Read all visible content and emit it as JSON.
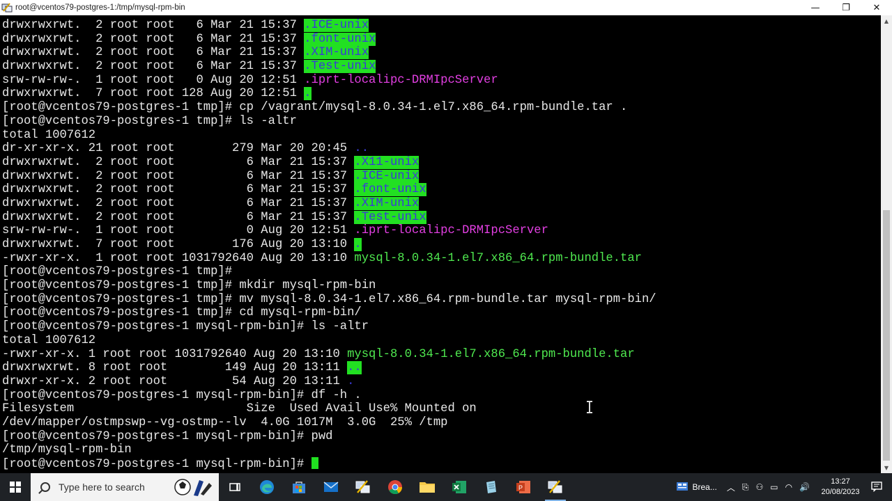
{
  "window": {
    "title": "root@vcentos79-postgres-1:/tmp/mysql-rpm-bin",
    "minimize_glyph": "—",
    "maximize_glyph": "❐",
    "close_glyph": "✕"
  },
  "terminal": {
    "lines": [
      [
        {
          "t": "drwxrwxrwt.  2 root root   6 Mar 21 15:37 "
        },
        {
          "t": ".ICE-unix",
          "c": "hl"
        }
      ],
      [
        {
          "t": "drwxrwxrwt.  2 root root   6 Mar 21 15:37 "
        },
        {
          "t": ".font-unix",
          "c": "hl"
        }
      ],
      [
        {
          "t": "drwxrwxrwt.  2 root root   6 Mar 21 15:37 "
        },
        {
          "t": ".XIM-unix",
          "c": "hl"
        }
      ],
      [
        {
          "t": "drwxrwxrwt.  2 root root   6 Mar 21 15:37 "
        },
        {
          "t": ".Test-unix",
          "c": "hl"
        }
      ],
      [
        {
          "t": "srw-rw-rw-.  1 root root   0 Aug 20 12:51 "
        },
        {
          "t": ".iprt-localipc-DRMIpcServer",
          "c": "magenta"
        }
      ],
      [
        {
          "t": "drwxrwxrwt.  7 root root 128 Aug 20 12:51 "
        },
        {
          "t": ".",
          "c": "hl"
        }
      ],
      [
        {
          "t": "[root@vcentos79-postgres-1 tmp]# cp /vagrant/mysql-8.0.34-1.el7.x86_64.rpm-bundle.tar ."
        }
      ],
      [
        {
          "t": "[root@vcentos79-postgres-1 tmp]# ls -altr"
        }
      ],
      [
        {
          "t": "total 1007612"
        }
      ],
      [
        {
          "t": "dr-xr-xr-x. 21 root root        279 Mar 20 20:45 "
        },
        {
          "t": "..",
          "c": "blue"
        }
      ],
      [
        {
          "t": "drwxrwxrwt.  2 root root          6 Mar 21 15:37 "
        },
        {
          "t": ".X11-unix",
          "c": "hl"
        }
      ],
      [
        {
          "t": "drwxrwxrwt.  2 root root          6 Mar 21 15:37 "
        },
        {
          "t": ".ICE-unix",
          "c": "hl"
        }
      ],
      [
        {
          "t": "drwxrwxrwt.  2 root root          6 Mar 21 15:37 "
        },
        {
          "t": ".font-unix",
          "c": "hl"
        }
      ],
      [
        {
          "t": "drwxrwxrwt.  2 root root          6 Mar 21 15:37 "
        },
        {
          "t": ".XIM-unix",
          "c": "hl"
        }
      ],
      [
        {
          "t": "drwxrwxrwt.  2 root root          6 Mar 21 15:37 "
        },
        {
          "t": ".Test-unix",
          "c": "hl"
        }
      ],
      [
        {
          "t": "srw-rw-rw-.  1 root root          0 Aug 20 12:51 "
        },
        {
          "t": ".iprt-localipc-DRMIpcServer",
          "c": "magenta"
        }
      ],
      [
        {
          "t": "drwxrwxrwt.  7 root root        176 Aug 20 13:10 "
        },
        {
          "t": ".",
          "c": "hl"
        }
      ],
      [
        {
          "t": "-rwxr-xr-x.  1 root root 1031792640 Aug 20 13:10 "
        },
        {
          "t": "mysql-8.0.34-1.el7.x86_64.rpm-bundle.tar",
          "c": "green"
        }
      ],
      [
        {
          "t": "[root@vcentos79-postgres-1 tmp]#"
        }
      ],
      [
        {
          "t": "[root@vcentos79-postgres-1 tmp]# mkdir mysql-rpm-bin"
        }
      ],
      [
        {
          "t": "[root@vcentos79-postgres-1 tmp]# mv mysql-8.0.34-1.el7.x86_64.rpm-bundle.tar mysql-rpm-bin/"
        }
      ],
      [
        {
          "t": "[root@vcentos79-postgres-1 tmp]# cd mysql-rpm-bin/"
        }
      ],
      [
        {
          "t": "[root@vcentos79-postgres-1 mysql-rpm-bin]# ls -altr"
        }
      ],
      [
        {
          "t": "total 1007612"
        }
      ],
      [
        {
          "t": "-rwxr-xr-x. 1 root root 1031792640 Aug 20 13:10 "
        },
        {
          "t": "mysql-8.0.34-1.el7.x86_64.rpm-bundle.tar",
          "c": "green"
        }
      ],
      [
        {
          "t": "drwxrwxrwt. 8 root root        149 Aug 20 13:11 "
        },
        {
          "t": "..",
          "c": "hl"
        }
      ],
      [
        {
          "t": "drwxr-xr-x. 2 root root         54 Aug 20 13:11 "
        },
        {
          "t": ".",
          "c": "blue"
        }
      ],
      [
        {
          "t": "[root@vcentos79-postgres-1 mysql-rpm-bin]# df -h ."
        }
      ],
      [
        {
          "t": "Filesystem                        Size  Used Avail Use% Mounted on"
        }
      ],
      [
        {
          "t": "/dev/mapper/ostmpswp--vg-ostmp--lv  4.0G 1017M  3.0G  25% /tmp"
        }
      ],
      [
        {
          "t": "[root@vcentos79-postgres-1 mysql-rpm-bin]# pwd"
        }
      ],
      [
        {
          "t": "/tmp/mysql-rpm-bin"
        }
      ],
      [
        {
          "t": "[root@vcentos79-postgres-1 mysql-rpm-bin]# "
        },
        {
          "t": "",
          "c": "cursor"
        }
      ]
    ]
  },
  "taskbar": {
    "search_placeholder": "Type here to search",
    "weather_text": "Brea...",
    "time": "13:27",
    "date": "20/08/2023"
  },
  "colors": {
    "highlight_bg": "#22e022",
    "highlight_fg": "#3a3ad8",
    "magenta": "#e23fe2",
    "green": "#4fe84f",
    "blue": "#3b3bd8",
    "taskbar": "#1f2226"
  }
}
